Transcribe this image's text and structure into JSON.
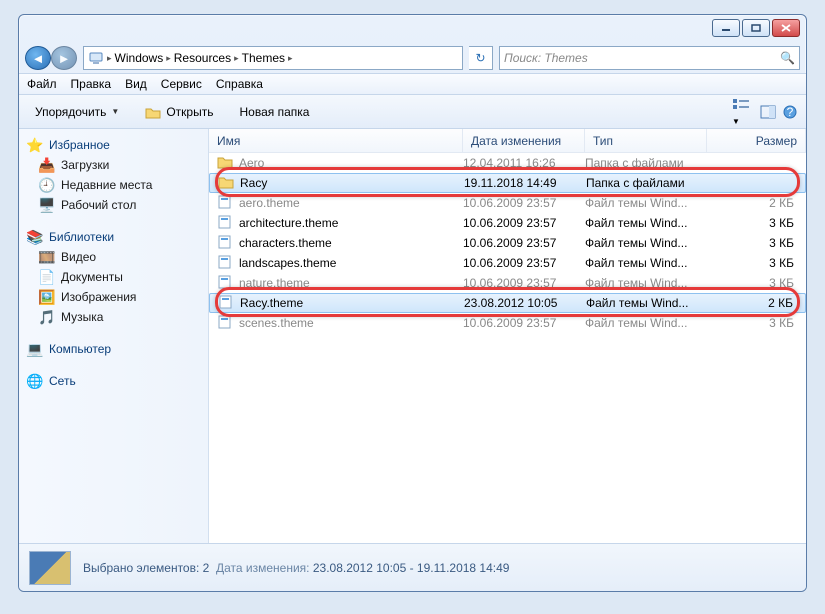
{
  "window": {
    "search_placeholder": "Поиск: Themes"
  },
  "breadcrumb": [
    "Windows",
    "Resources",
    "Themes"
  ],
  "menu": [
    "Файл",
    "Правка",
    "Вид",
    "Сервис",
    "Справка"
  ],
  "toolbar": {
    "organize": "Упорядочить",
    "open": "Открыть",
    "new_folder": "Новая папка"
  },
  "nav": {
    "favorites": {
      "label": "Избранное",
      "items": [
        "Загрузки",
        "Недавние места",
        "Рабочий стол"
      ]
    },
    "libraries": {
      "label": "Библиотеки",
      "items": [
        "Видео",
        "Документы",
        "Изображения",
        "Музыка"
      ]
    },
    "computer": {
      "label": "Компьютер"
    },
    "network": {
      "label": "Сеть"
    }
  },
  "columns": {
    "name": "Имя",
    "date": "Дата изменения",
    "type": "Тип",
    "size": "Размер"
  },
  "files": [
    {
      "name": "Aero",
      "date": "12.04.2011 16:26",
      "type": "Папка с файлами",
      "size": "",
      "kind": "folder",
      "sel": false,
      "light": true
    },
    {
      "name": "Racy",
      "date": "19.11.2018 14:49",
      "type": "Папка с файлами",
      "size": "",
      "kind": "folder",
      "sel": true,
      "light": false,
      "hl": true
    },
    {
      "name": "aero.theme",
      "date": "10.06.2009 23:57",
      "type": "Файл темы Wind...",
      "size": "2 КБ",
      "kind": "theme",
      "sel": false,
      "light": true
    },
    {
      "name": "architecture.theme",
      "date": "10.06.2009 23:57",
      "type": "Файл темы Wind...",
      "size": "3 КБ",
      "kind": "theme",
      "sel": false,
      "light": false
    },
    {
      "name": "characters.theme",
      "date": "10.06.2009 23:57",
      "type": "Файл темы Wind...",
      "size": "3 КБ",
      "kind": "theme",
      "sel": false,
      "light": false
    },
    {
      "name": "landscapes.theme",
      "date": "10.06.2009 23:57",
      "type": "Файл темы Wind...",
      "size": "3 КБ",
      "kind": "theme",
      "sel": false,
      "light": false
    },
    {
      "name": "nature.theme",
      "date": "10.06.2009 23:57",
      "type": "Файл темы Wind...",
      "size": "3 КБ",
      "kind": "theme",
      "sel": false,
      "light": true
    },
    {
      "name": "Racy.theme",
      "date": "23.08.2012 10:05",
      "type": "Файл темы Wind...",
      "size": "2 КБ",
      "kind": "theme",
      "sel": true,
      "light": false,
      "hl": true
    },
    {
      "name": "scenes.theme",
      "date": "10.06.2009 23:57",
      "type": "Файл темы Wind...",
      "size": "3 КБ",
      "kind": "theme",
      "sel": false,
      "light": true
    }
  ],
  "status": {
    "selection": "Выбрано элементов: 2",
    "date_label": "Дата изменения:",
    "date_value": "23.08.2012 10:05 - 19.11.2018 14:49"
  }
}
